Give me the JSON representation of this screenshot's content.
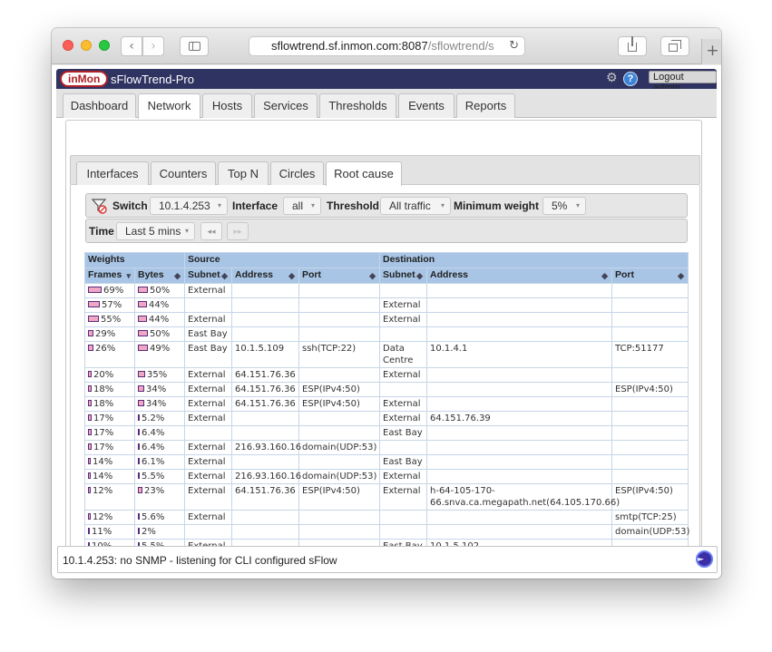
{
  "browser": {
    "url_host": "sflowtrend.sf.inmon.com:8087",
    "url_path": "/sflowtrend/s"
  },
  "app": {
    "logo_text": "inMon",
    "title": "sFlowTrend-Pro",
    "logout_label": "Logout admin",
    "help_label": "?"
  },
  "main_tabs": [
    "Dashboard",
    "Network",
    "Hosts",
    "Services",
    "Thresholds",
    "Events",
    "Reports"
  ],
  "active_main_tab": "Network",
  "sub_tabs": [
    "Interfaces",
    "Counters",
    "Top N",
    "Circles",
    "Root cause"
  ],
  "active_sub_tab": "Root cause",
  "filters": {
    "switch_label": "Switch",
    "switch_value": "10.1.4.253",
    "interface_label": "Interface",
    "interface_value": "all",
    "threshold_label": "Threshold",
    "threshold_value": "All traffic",
    "min_weight_label": "Minimum weight",
    "min_weight_value": "5%",
    "time_label": "Time",
    "time_value": "Last 5 mins"
  },
  "table": {
    "groups": [
      "Weights",
      "Source",
      "Destination"
    ],
    "columns": [
      "Frames",
      "Bytes",
      "Subnet",
      "Address",
      "Port",
      "Subnet",
      "Address",
      "Port"
    ],
    "rows": [
      {
        "frames": "69%",
        "bytes": "50%",
        "src_subnet": "External",
        "src_address": "",
        "src_port": "",
        "dst_subnet": "",
        "dst_address": "",
        "dst_port": ""
      },
      {
        "frames": "57%",
        "bytes": "44%",
        "src_subnet": "",
        "src_address": "",
        "src_port": "",
        "dst_subnet": "External",
        "dst_address": "",
        "dst_port": ""
      },
      {
        "frames": "55%",
        "bytes": "44%",
        "src_subnet": "External",
        "src_address": "",
        "src_port": "",
        "dst_subnet": "External",
        "dst_address": "",
        "dst_port": ""
      },
      {
        "frames": "29%",
        "bytes": "50%",
        "src_subnet": "East Bay",
        "src_address": "",
        "src_port": "",
        "dst_subnet": "",
        "dst_address": "",
        "dst_port": ""
      },
      {
        "frames": "26%",
        "bytes": "49%",
        "src_subnet": "East Bay",
        "src_address": "10.1.5.109",
        "src_port": "ssh(TCP:22)",
        "dst_subnet": "Data Centre",
        "dst_address": "10.1.4.1",
        "dst_port": "TCP:51177"
      },
      {
        "frames": "20%",
        "bytes": "35%",
        "src_subnet": "External",
        "src_address": "64.151.76.36",
        "src_port": "",
        "dst_subnet": "External",
        "dst_address": "",
        "dst_port": ""
      },
      {
        "frames": "18%",
        "bytes": "34%",
        "src_subnet": "External",
        "src_address": "64.151.76.36",
        "src_port": "ESP(IPv4:50)",
        "dst_subnet": "",
        "dst_address": "",
        "dst_port": "ESP(IPv4:50)"
      },
      {
        "frames": "18%",
        "bytes": "34%",
        "src_subnet": "External",
        "src_address": "64.151.76.36",
        "src_port": "ESP(IPv4:50)",
        "dst_subnet": "External",
        "dst_address": "",
        "dst_port": ""
      },
      {
        "frames": "17%",
        "bytes": "5.2%",
        "src_subnet": "External",
        "src_address": "",
        "src_port": "",
        "dst_subnet": "External",
        "dst_address": "64.151.76.39",
        "dst_port": ""
      },
      {
        "frames": "17%",
        "bytes": "6.4%",
        "src_subnet": "",
        "src_address": "",
        "src_port": "",
        "dst_subnet": "East Bay",
        "dst_address": "",
        "dst_port": ""
      },
      {
        "frames": "17%",
        "bytes": "6.4%",
        "src_subnet": "External",
        "src_address": "216.93.160.16",
        "src_port": "domain(UDP:53)",
        "dst_subnet": "",
        "dst_address": "",
        "dst_port": ""
      },
      {
        "frames": "14%",
        "bytes": "6.1%",
        "src_subnet": "External",
        "src_address": "",
        "src_port": "",
        "dst_subnet": "East Bay",
        "dst_address": "",
        "dst_port": ""
      },
      {
        "frames": "14%",
        "bytes": "5.5%",
        "src_subnet": "External",
        "src_address": "216.93.160.16",
        "src_port": "domain(UDP:53)",
        "dst_subnet": "External",
        "dst_address": "",
        "dst_port": ""
      },
      {
        "frames": "12%",
        "bytes": "23%",
        "src_subnet": "External",
        "src_address": "64.151.76.36",
        "src_port": "ESP(IPv4:50)",
        "dst_subnet": "External",
        "dst_address": "h-64-105-170-66.snva.ca.megapath.net(64.105.170.66)",
        "dst_port": "ESP(IPv4:50)"
      },
      {
        "frames": "12%",
        "bytes": "5.6%",
        "src_subnet": "External",
        "src_address": "",
        "src_port": "",
        "dst_subnet": "",
        "dst_address": "",
        "dst_port": "smtp(TCP:25)"
      },
      {
        "frames": "11%",
        "bytes": "2%",
        "src_subnet": "",
        "src_address": "",
        "src_port": "",
        "dst_subnet": "",
        "dst_address": "",
        "dst_port": "domain(UDP:53)"
      },
      {
        "frames": "10%",
        "bytes": "5.5%",
        "src_subnet": "External",
        "src_address": "",
        "src_port": "",
        "dst_subnet": "East Bay",
        "dst_address": "10.1.5.102",
        "dst_port": ""
      }
    ]
  },
  "status": {
    "text": "10.1.4.253: no SNMP - listening for CLI configured sFlow"
  },
  "colors": {
    "appbar": "#2f3361",
    "table_header": "#a8c5e6",
    "bar_fill": "#f0a7c4",
    "bar_border": "#5a2a7a"
  }
}
